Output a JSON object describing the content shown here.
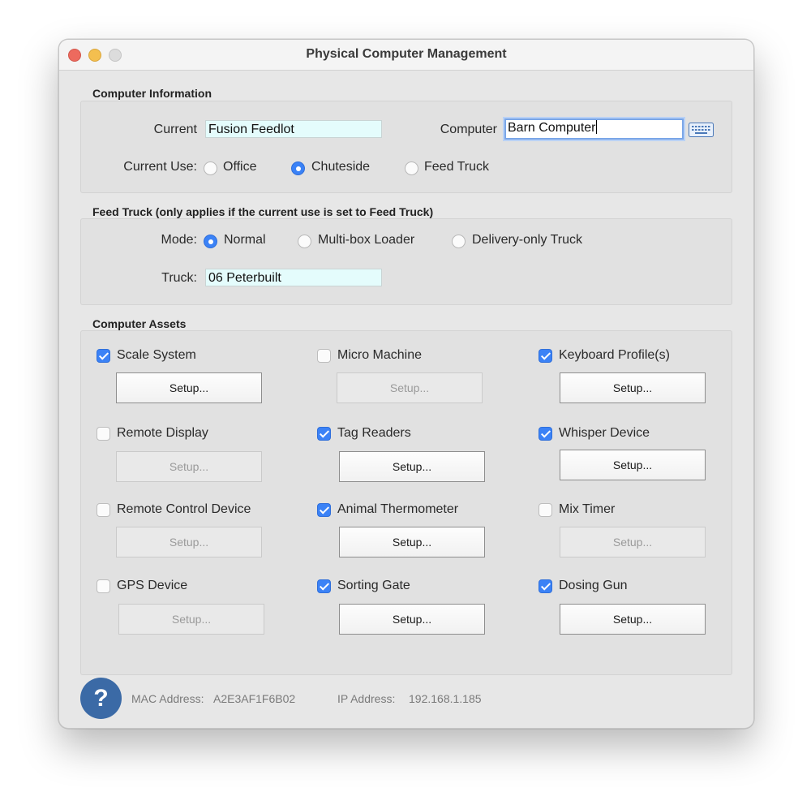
{
  "window": {
    "title": "Physical Computer Management"
  },
  "computer_info": {
    "section_title": "Computer Information",
    "current_label": "Current",
    "current_value": "Fusion Feedlot",
    "computer_label": "Computer",
    "computer_value": "Barn Computer",
    "current_use_label": "Current Use:",
    "use_options": [
      "Office",
      "Chuteside",
      "Feed Truck"
    ],
    "use_selected": "Chuteside"
  },
  "feed_truck": {
    "section_title": "Feed Truck (only applies if the current use is set to Feed Truck)",
    "mode_label": "Mode:",
    "mode_options": [
      "Normal",
      "Multi-box Loader",
      "Delivery-only Truck"
    ],
    "mode_selected": "Normal",
    "truck_label": "Truck:",
    "truck_value": "06 Peterbuilt"
  },
  "assets": {
    "section_title": "Computer Assets",
    "setup_label": "Setup...",
    "items": [
      {
        "label": "Scale System",
        "checked": true
      },
      {
        "label": "Micro Machine",
        "checked": false
      },
      {
        "label": "Keyboard Profile(s)",
        "checked": true
      },
      {
        "label": "Remote Display",
        "checked": false
      },
      {
        "label": "Tag Readers",
        "checked": true
      },
      {
        "label": "Whisper Device",
        "checked": true
      },
      {
        "label": "Remote Control Device",
        "checked": false
      },
      {
        "label": "Animal Thermometer",
        "checked": true
      },
      {
        "label": "Mix Timer",
        "checked": false
      },
      {
        "label": "GPS Device",
        "checked": false
      },
      {
        "label": "Sorting Gate",
        "checked": true
      },
      {
        "label": "Dosing Gun",
        "checked": true
      }
    ]
  },
  "footer": {
    "help_glyph": "?",
    "mac_label": "MAC Address:",
    "mac_value": "A2E3AF1F6B02",
    "ip_label": "IP Address:",
    "ip_value": "192.168.1.185"
  },
  "colors": {
    "accent": "#3b82f6",
    "field_bg": "#e4fcfc",
    "help_bg": "#3b6aa6"
  }
}
